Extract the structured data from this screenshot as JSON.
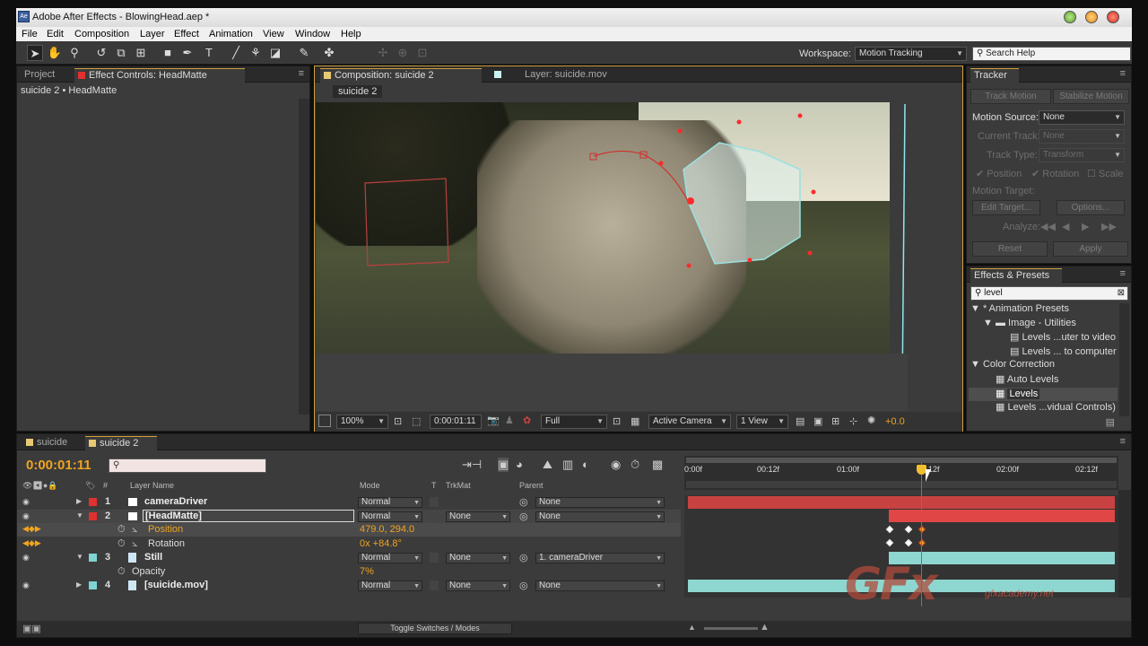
{
  "titlebar": {
    "title": "Adobe After Effects - BlowingHead.aep *",
    "app_icon": "Ae"
  },
  "menu": [
    "File",
    "Edit",
    "Composition",
    "Layer",
    "Effect",
    "Animation",
    "View",
    "Window",
    "Help"
  ],
  "toolbar": {
    "workspace_label": "Workspace:",
    "workspace_value": "Motion Tracking",
    "search_placeholder": "Search Help"
  },
  "project_panel": {
    "tab_project": "Project",
    "tab_effect_controls": "Effect Controls: HeadMatte",
    "breadcrumb": "suicide 2 • HeadMatte"
  },
  "comp_panel": {
    "tab_composition": "Composition: suicide 2",
    "tab_layer": "Layer: suicide.mov",
    "comp_label": "suicide 2",
    "zoom": "100%",
    "timecode": "0:00:01:11",
    "resolution": "Full",
    "camera": "Active Camera",
    "view": "1 View",
    "exposure": "+0.0"
  },
  "tracker": {
    "tab": "Tracker",
    "track_motion": "Track Motion",
    "stabilize_motion": "Stabilize Motion",
    "motion_source_label": "Motion Source:",
    "motion_source_value": "None",
    "current_track_label": "Current Track:",
    "current_track_value": "None",
    "track_type_label": "Track Type:",
    "track_type_value": "Transform",
    "position": "Position",
    "rotation": "Rotation",
    "scale": "Scale",
    "motion_target": "Motion Target:",
    "edit_target": "Edit Target...",
    "options": "Options...",
    "analyze": "Analyze:",
    "reset": "Reset",
    "apply": "Apply"
  },
  "effects_presets": {
    "tab": "Effects & Presets",
    "search_value": "level",
    "tree": [
      {
        "label": "* Animation Presets",
        "indent": 0,
        "type": "folder-open"
      },
      {
        "label": "Image - Utilities",
        "indent": 1,
        "type": "folder"
      },
      {
        "label": "Levels ...uter to video",
        "indent": 2,
        "type": "preset"
      },
      {
        "label": "Levels ... to computer",
        "indent": 2,
        "type": "preset"
      },
      {
        "label": "Color Correction",
        "indent": 0,
        "type": "folder-open"
      },
      {
        "label": "Auto Levels",
        "indent": 1,
        "type": "effect"
      },
      {
        "label": "Levels",
        "indent": 1,
        "type": "effect",
        "selected": true
      },
      {
        "label": "Levels ...vidual Controls)",
        "indent": 1,
        "type": "effect"
      }
    ]
  },
  "timeline": {
    "tab1": "suicide",
    "tab2": "suicide 2",
    "timecode": "0:00:01:11",
    "col_hash": "#",
    "col_layer_name": "Layer Name",
    "col_mode": "Mode",
    "col_t": "T",
    "col_trkmat": "TrkMat",
    "col_parent": "Parent",
    "ruler": [
      "0:00f",
      "00:12f",
      "01:00f",
      "12f",
      "02:00f",
      "02:12f"
    ],
    "layers": [
      {
        "num": "1",
        "name": "cameraDriver",
        "mode": "Normal",
        "trkmat": "",
        "parent": "None",
        "color": "#e03030"
      },
      {
        "num": "2",
        "name": "[HeadMatte]",
        "mode": "Normal",
        "trkmat": "None",
        "parent": "None",
        "color": "#e03030"
      },
      {
        "prop": "Position",
        "value": "479.0, 294.0"
      },
      {
        "prop": "Rotation",
        "value": "0x +84.8°"
      },
      {
        "num": "3",
        "name": "Still",
        "mode": "Normal",
        "trkmat": "None",
        "parent": "1. cameraDriver",
        "color": "#7fd3d3"
      },
      {
        "prop": "Opacity",
        "value": "7%"
      },
      {
        "num": "4",
        "name": "[suicide.mov]",
        "mode": "Normal",
        "trkmat": "None",
        "parent": "None",
        "color": "#7fd3d3"
      }
    ],
    "toggle": "Toggle Switches / Modes"
  },
  "watermark": {
    "logo": "GFx",
    "site": "gfxacademy.net"
  }
}
